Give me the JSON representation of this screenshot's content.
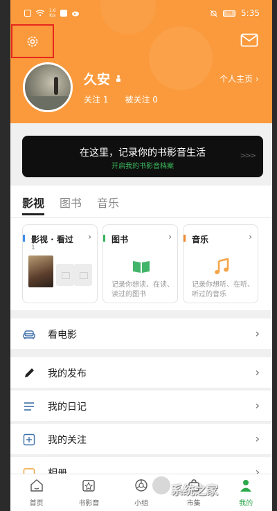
{
  "status_bar": {
    "speed_top": "1.6",
    "speed_bottom": "K/s",
    "battery": "86",
    "time": "5:35"
  },
  "profile": {
    "username": "久安",
    "homepage_link": "个人主页",
    "following": "关注 1",
    "followers": "被关注 0"
  },
  "banner": {
    "title": "在这里，记录你的书影音生活",
    "subtitle": "开启我的书影音档案",
    "arrows": ">>>"
  },
  "tabs": [
    {
      "label": "影视"
    },
    {
      "label": "图书"
    },
    {
      "label": "音乐"
    }
  ],
  "cards": [
    {
      "title": "影视 · 看过",
      "count": "1",
      "accent": "#3d8ef0"
    },
    {
      "title": "图书",
      "desc": "记录你想读、在读、读过的图书",
      "accent": "#35b35a"
    },
    {
      "title": "音乐",
      "desc": "记录你想听、在听、听过的音乐",
      "accent": "#f08a2c"
    }
  ],
  "list": [
    {
      "label": "看电影",
      "icon": "sofa-icon"
    },
    {
      "label": "我的发布",
      "icon": "pen-icon"
    },
    {
      "label": "我的日记",
      "icon": "lines-icon"
    },
    {
      "label": "我的关注",
      "icon": "plus-box-icon"
    },
    {
      "label": "相册",
      "icon": "album-icon"
    }
  ],
  "nav": [
    {
      "label": "首页",
      "icon": "home-icon"
    },
    {
      "label": "书影音",
      "icon": "star-box-icon"
    },
    {
      "label": "小组",
      "icon": "group-icon"
    },
    {
      "label": "市集",
      "icon": "market-icon"
    },
    {
      "label": "我的",
      "icon": "profile-icon"
    }
  ],
  "watermark": "系统之家",
  "colors": {
    "header": "#fa9a3c",
    "highlight_box": "#e8271e",
    "nav_active": "#2aa84a"
  }
}
